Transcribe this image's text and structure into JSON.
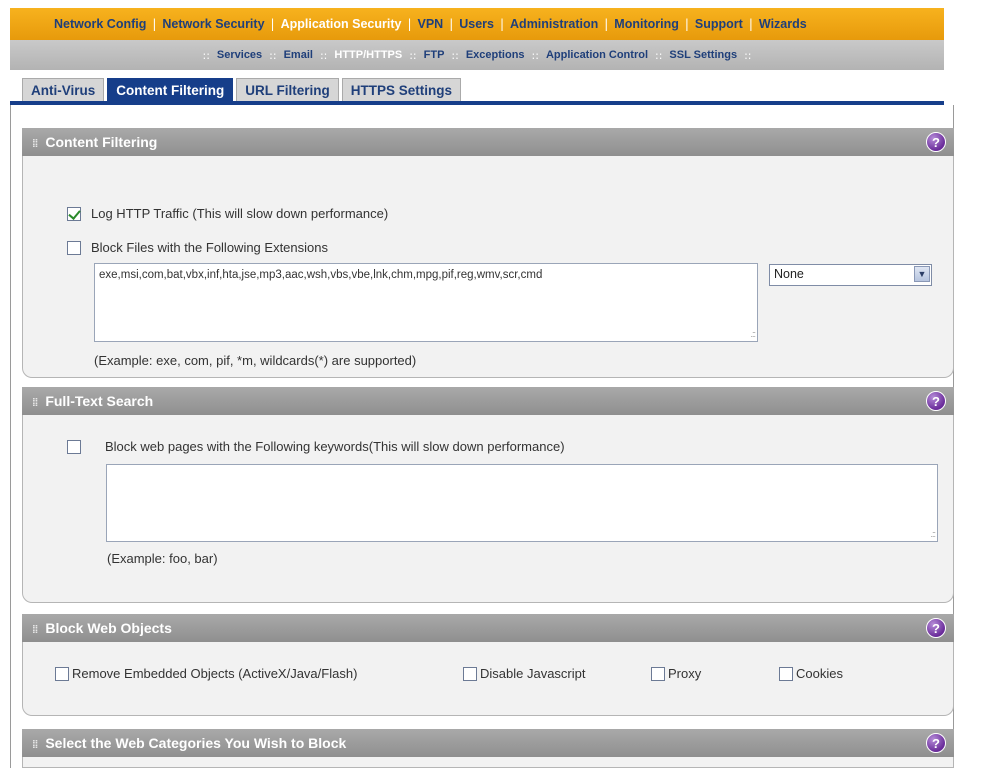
{
  "top_nav": {
    "items": [
      {
        "label": "Network Config"
      },
      {
        "label": "Network Security"
      },
      {
        "label": "Application Security"
      },
      {
        "label": "VPN"
      },
      {
        "label": "Users"
      },
      {
        "label": "Administration"
      },
      {
        "label": "Monitoring"
      },
      {
        "label": "Support"
      },
      {
        "label": "Wizards"
      }
    ],
    "active": "Application Security"
  },
  "sub_nav": {
    "items": [
      {
        "label": "Services"
      },
      {
        "label": "Email"
      },
      {
        "label": "HTTP/HTTPS"
      },
      {
        "label": "FTP"
      },
      {
        "label": "Exceptions"
      },
      {
        "label": "Application Control"
      },
      {
        "label": "SSL Settings"
      }
    ],
    "active": "HTTP/HTTPS"
  },
  "tabs": [
    {
      "label": "Anti-Virus"
    },
    {
      "label": "Content Filtering"
    },
    {
      "label": "URL Filtering"
    },
    {
      "label": "HTTPS Settings"
    }
  ],
  "active_tab": "Content Filtering",
  "content_filtering": {
    "title": "Content Filtering",
    "log_http_label": "Log HTTP Traffic (This will slow down performance)",
    "log_http_checked": true,
    "block_ext_label": "Block Files with the Following Extensions",
    "block_ext_checked": false,
    "extensions_value": "exe,msi,com,bat,vbx,inf,hta,jse,mp3,aac,wsh,vbs,vbe,lnk,chm,mpg,pif,reg,wmv,scr,cmd",
    "preset_select_value": "None",
    "example": "(Example: exe, com, pif, *m, wildcards(*) are supported)"
  },
  "full_text_search": {
    "title": "Full-Text Search",
    "block_keywords_label": "Block web pages with the Following keywords(This will slow down performance)",
    "block_keywords_checked": false,
    "keywords_value": "",
    "example": "(Example: foo, bar)"
  },
  "block_web_objects": {
    "title": "Block Web Objects",
    "options": [
      {
        "label": "Remove Embedded Objects (ActiveX/Java/Flash)",
        "checked": false
      },
      {
        "label": "Disable Javascript",
        "checked": false
      },
      {
        "label": "Proxy",
        "checked": false
      },
      {
        "label": "Cookies",
        "checked": false
      }
    ]
  },
  "web_categories": {
    "title": "Select the Web Categories You Wish to Block"
  },
  "help_icon_glyph": "?",
  "colors": {
    "top_nav_bg": "#f0a515",
    "nav_text": "#1f3f7a",
    "active_tab_bg": "#163e8a",
    "section_header_bg": "#999999",
    "help_icon": "#7a3aa8"
  }
}
